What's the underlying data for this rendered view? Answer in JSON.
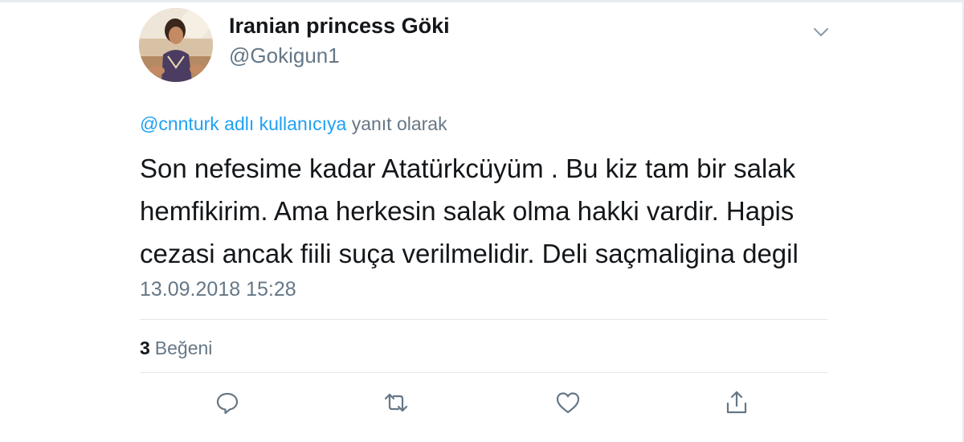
{
  "user": {
    "display_name": "Iranian princess Göki",
    "handle": "@Gokigun1"
  },
  "reply": {
    "mention": "@cnnturk adlı kullanıcıya",
    "suffix": "yanıt olarak"
  },
  "tweet": {
    "text": "Son nefesime kadar Atatürkcüyüm . Bu kiz tam bir salak hemfikirim. Ama herkesin salak olma hakki vardir. Hapis cezasi ancak fiili suça verilmelidir. Deli saçmaligina degil",
    "timestamp": "13.09.2018 15:28"
  },
  "stats": {
    "like_count": "3",
    "like_label": "Beğeni"
  },
  "icons": {
    "caret": "chevron-down-icon",
    "reply": "reply-icon",
    "retweet": "retweet-icon",
    "like": "heart-icon",
    "share": "share-icon"
  },
  "colors": {
    "link": "#1da1f2",
    "secondary_text": "#657786",
    "primary_text": "#14171a",
    "divider": "#e1e8ed"
  }
}
